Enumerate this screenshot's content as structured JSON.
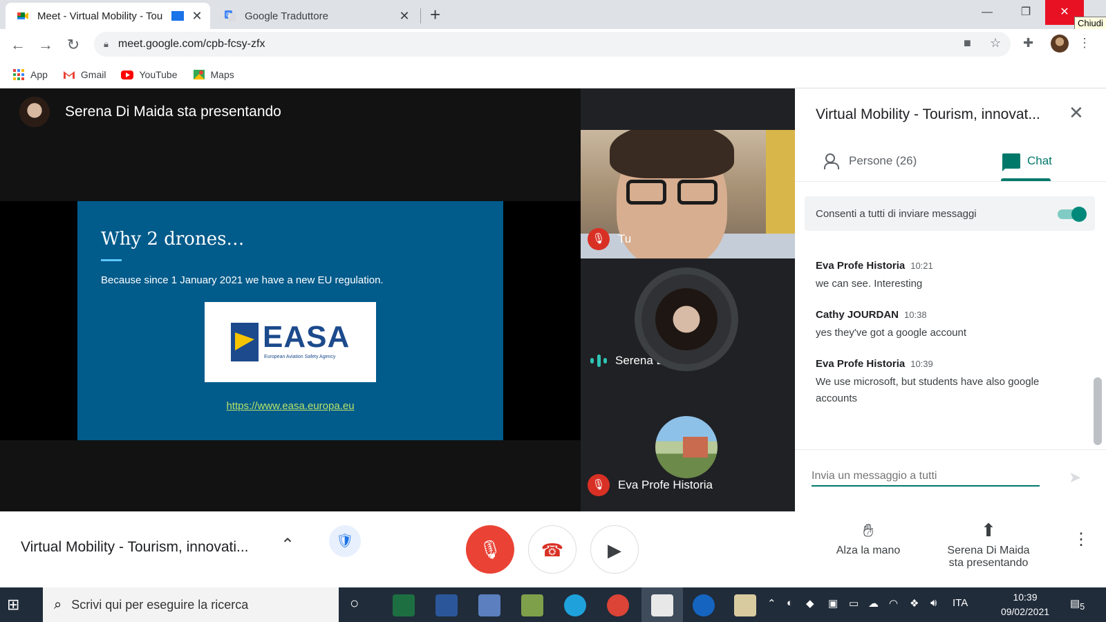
{
  "browser": {
    "tabs": [
      {
        "title": "Meet - Virtual Mobility - Tou",
        "active": true
      },
      {
        "title": "Google Traduttore",
        "active": false
      }
    ],
    "url": "meet.google.com/cpb-fcsy-zfx",
    "close_tooltip": "Chiudi",
    "bookmarks": [
      {
        "label": "App",
        "icon": "apps-grid-icon"
      },
      {
        "label": "Gmail",
        "icon": "gmail-icon"
      },
      {
        "label": "YouTube",
        "icon": "youtube-icon"
      },
      {
        "label": "Maps",
        "icon": "maps-icon"
      }
    ]
  },
  "stage": {
    "presenting_label": "Serena Di Maida sta presentando",
    "slide": {
      "title": "Why 2 drones…",
      "text": "Because since 1 January 2021 we have a new EU regulation.",
      "logo_text": "EASA",
      "logo_subtext": "European Aviation Safety Agency",
      "link": "https://www.easa.europa.eu"
    },
    "participants": [
      {
        "name": "Tu",
        "muted": true
      },
      {
        "name": "Serena Di Maida",
        "muted": false,
        "speaking": true
      },
      {
        "name": "Eva Profe Historia",
        "muted": true
      }
    ]
  },
  "panel": {
    "title": "Virtual Mobility - Tourism, innovat...",
    "tab_people": "Persone (26)",
    "tab_chat": "Chat",
    "allow_label": "Consenti a tutti di inviare messaggi",
    "allow_enabled": true,
    "messages": [
      {
        "author": "Eva Profe Historia",
        "time": "10:21",
        "text": "we can see. Interesting"
      },
      {
        "author": "Cathy JOURDAN",
        "time": "10:38",
        "text": "yes they've got a google account"
      },
      {
        "author": "Eva Profe Historia",
        "time": "10:39",
        "text": "We use microsoft, but students have also google accounts"
      }
    ],
    "input_placeholder": "Invia un messaggio a tutti"
  },
  "controls": {
    "meeting_title": "Virtual Mobility - Tourism, innovati...",
    "raise_hand": "Alza la mano",
    "presenting_line1": "Serena Di Maida",
    "presenting_line2": "sta presentando"
  },
  "taskbar": {
    "search_placeholder": "Scrivi qui per eseguire la ricerca",
    "language": "ITA",
    "time": "10:39",
    "date": "09/02/2021",
    "notifications": "5"
  },
  "colors": {
    "meet_teal": "#00796b",
    "end_call_red": "#ea4335",
    "slide_blue": "#015b8b",
    "link_green": "#b9e36a"
  }
}
